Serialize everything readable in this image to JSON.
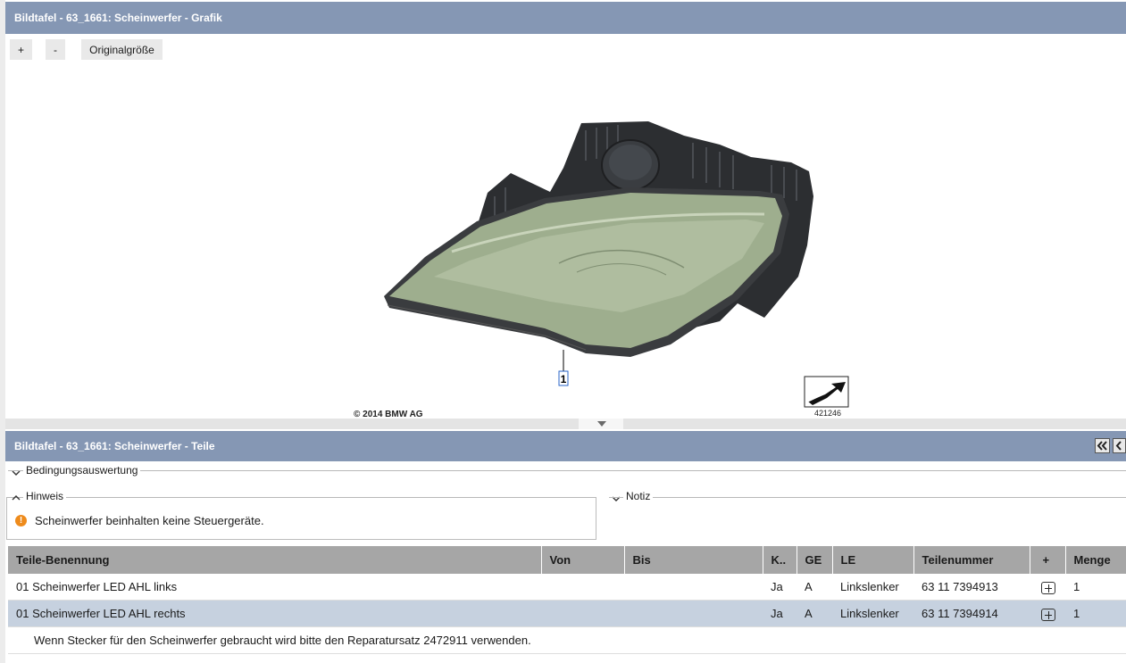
{
  "graphic": {
    "title": "Bildtafel - 63_1661: Scheinwerfer - Grafik",
    "zoom_in": "+",
    "zoom_out": "-",
    "original_size": "Originalgröße",
    "callout": "1",
    "copyright": "© 2014 BMW AG",
    "image_number": "421246"
  },
  "parts_panel": {
    "title": "Bildtafel - 63_1661: Scheinwerfer - Teile",
    "conditions_label": "Bedingungsauswertung",
    "hint_label": "Hinweis",
    "hint_text": "Scheinwerfer beinhalten keine Steuergeräte.",
    "note_label": "Notiz"
  },
  "table": {
    "headers": {
      "name": "Teile-Benennung",
      "from": "Von",
      "to": "Bis",
      "k": "K..",
      "ge": "GE",
      "le": "LE",
      "part_no": "Teilenummer",
      "plus": "+",
      "qty": "Menge"
    },
    "rows": [
      {
        "name": "01 Scheinwerfer LED AHL links",
        "from": "",
        "to": "",
        "k": "Ja",
        "ge": "A",
        "le": "Linkslenker",
        "part_no": "63 11 7394913",
        "qty": "1"
      },
      {
        "name": "01 Scheinwerfer LED AHL rechts",
        "from": "",
        "to": "",
        "k": "Ja",
        "ge": "A",
        "le": "Linkslenker",
        "part_no": "63 11 7394914",
        "qty": "1"
      }
    ],
    "note": "Wenn Stecker für den Scheinwerfer gebraucht wird bitte den Reparatursatz 2472911 verwenden."
  },
  "icons": {
    "collapse_all": "double-chevron-left-icon",
    "collapse": "chevron-left-icon",
    "warning": "warning-circle-icon",
    "add_to_cart": "plus-square-icon",
    "direction": "direction-arrow-icon"
  },
  "colors": {
    "header": "#8597b4",
    "selected_row": "#c6d1df",
    "table_header": "#a6a6a6",
    "warning": "#ee8b1c"
  }
}
